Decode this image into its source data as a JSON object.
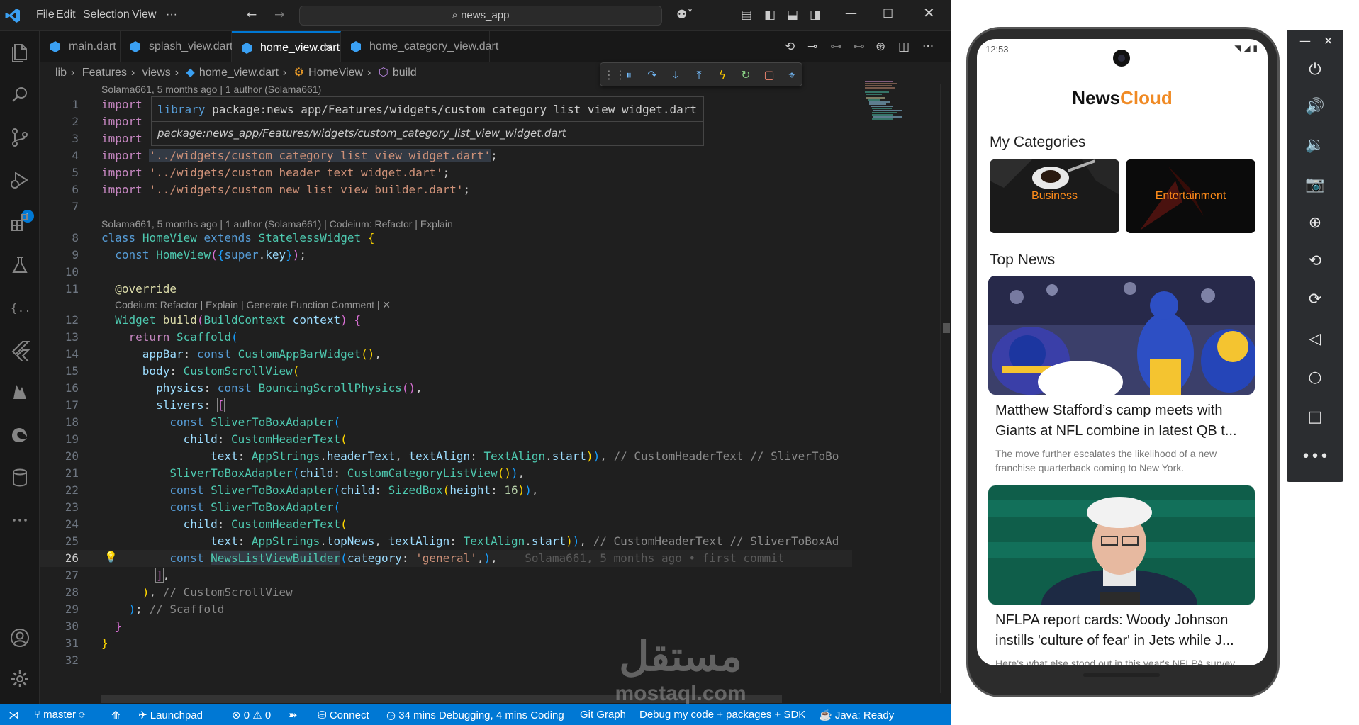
{
  "titlebar": {
    "menus": [
      "File",
      "Edit",
      "Selection",
      "View",
      "···"
    ],
    "search_text": "news_app"
  },
  "tabs": [
    {
      "label": "main.dart"
    },
    {
      "label": "splash_view.dart"
    },
    {
      "label": "home_view.dart",
      "active": true
    },
    {
      "label": "home_category_view.dart"
    }
  ],
  "breadcrumb": [
    "lib",
    "›",
    "Features",
    "›",
    "views",
    "›",
    "home_view.dart",
    "›",
    "HomeView",
    "›",
    "build"
  ],
  "activity_badge": "1",
  "hover": {
    "kind": "library",
    "package": "package:news_app/Features/widgets/custom_category_list_view_widget.dart",
    "package_italic": "package:news_app/Features/widgets/custom_category_list_view_widget.dart"
  },
  "codelens": {
    "top": "Solama661, 5 months ago | 1 author (Solama661)",
    "class": "Solama661, 5 months ago | 1 author (Solama661) | Codeium: Refactor | Explain",
    "method": "Codeium: Refactor | Explain | Generate Function Comment | ✕"
  },
  "code": {
    "l1": "import",
    "l2": "import",
    "l3": "import",
    "l4_kw": "import",
    "l4_str": "'../widgets/custom_category_list_view_widget.dart'",
    "l5_kw": "import",
    "l5_str": "'../widgets/custom_header_text_widget.dart'",
    "l6_kw": "import",
    "l6_str": "'../widgets/custom_new_list_view_builder.dart'",
    "blame26": "Solama661, 5 months ago • first commit"
  },
  "statusbar": {
    "branch": "master",
    "launchpad": "Launchpad",
    "problems": "⊗ 0 ⚠ 0",
    "connect": "Connect",
    "time": "34 mins Debugging, 4 mins Coding",
    "git_graph": "Git Graph",
    "debug": "Debug my code + packages + SDK",
    "java": "Java: Ready"
  },
  "phone": {
    "time": "12:53",
    "brand_a": "News",
    "brand_b": "Cloud",
    "my_categories": "My Categories",
    "categories": [
      "Business",
      "Entertainment"
    ],
    "top_news": "Top News",
    "news": [
      {
        "title": "Matthew Stafford’s camp meets with Giants at NFL combine in latest QB t...",
        "desc": "The move further escalates the likelihood of a new franchise quarterback coming to New York."
      },
      {
        "title": "NFLPA report cards: Woody Johnson instills 'culture of fear' in Jets while J...",
        "desc": "Here's what else stood out in this year's NFLPA survey."
      }
    ]
  },
  "watermark": {
    "arabic": "مستقل",
    "latin": "mostaql.com"
  },
  "colors": {
    "accent": "#0078d4",
    "brand_orange": "#f08a24",
    "editor_bg": "#1f1f1f"
  }
}
